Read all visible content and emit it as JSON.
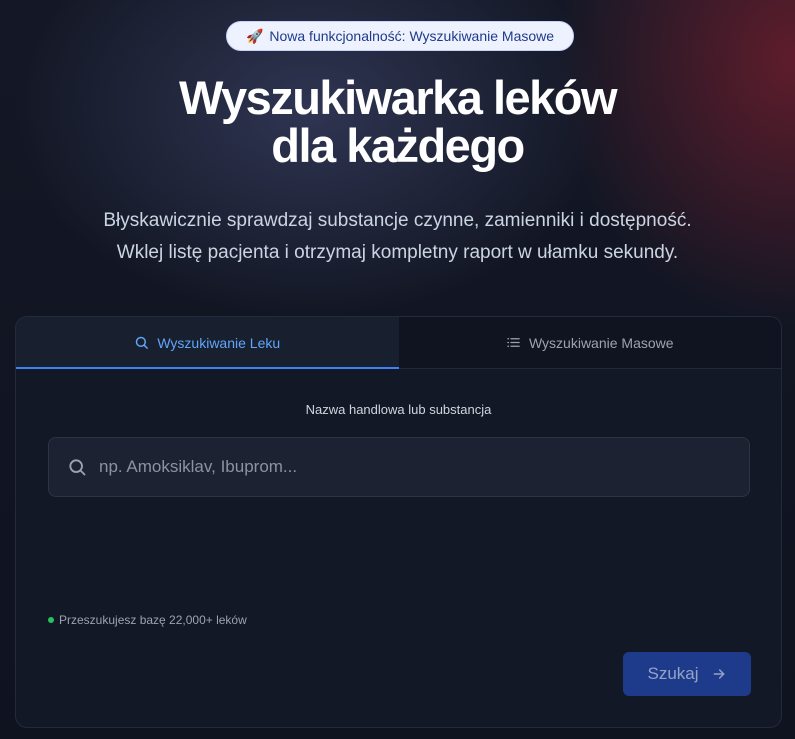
{
  "badge": {
    "icon": "rocket-icon",
    "text": "Nowa funkcjonalność: Wyszukiwanie Masowe"
  },
  "hero": {
    "title_line1": "Wyszukiwarka leków",
    "title_line2": "dla każdego",
    "subtitle_line1": "Błyskawicznie sprawdzaj substancje czynne, zamienniki i dostępność.",
    "subtitle_line2": "Wklej listę pacjenta i otrzymaj kompletny raport w ułamku sekundy."
  },
  "tabs": [
    {
      "label": "Wyszukiwanie Leku",
      "icon": "search-icon",
      "active": true
    },
    {
      "label": "Wyszukiwanie Masowe",
      "icon": "list-icon",
      "active": false
    }
  ],
  "search": {
    "label": "Nazwa handlowa lub substancja",
    "value": "",
    "placeholder": "np. Amoksiklav, Ibuprom..."
  },
  "status": {
    "text": "Przeszukujesz bazę 22,000+ leków"
  },
  "submit": {
    "label": "Szukaj"
  },
  "colors": {
    "accent": "#3b82f6",
    "status_dot": "#22c55e",
    "button_bg": "#1e3a8a"
  }
}
